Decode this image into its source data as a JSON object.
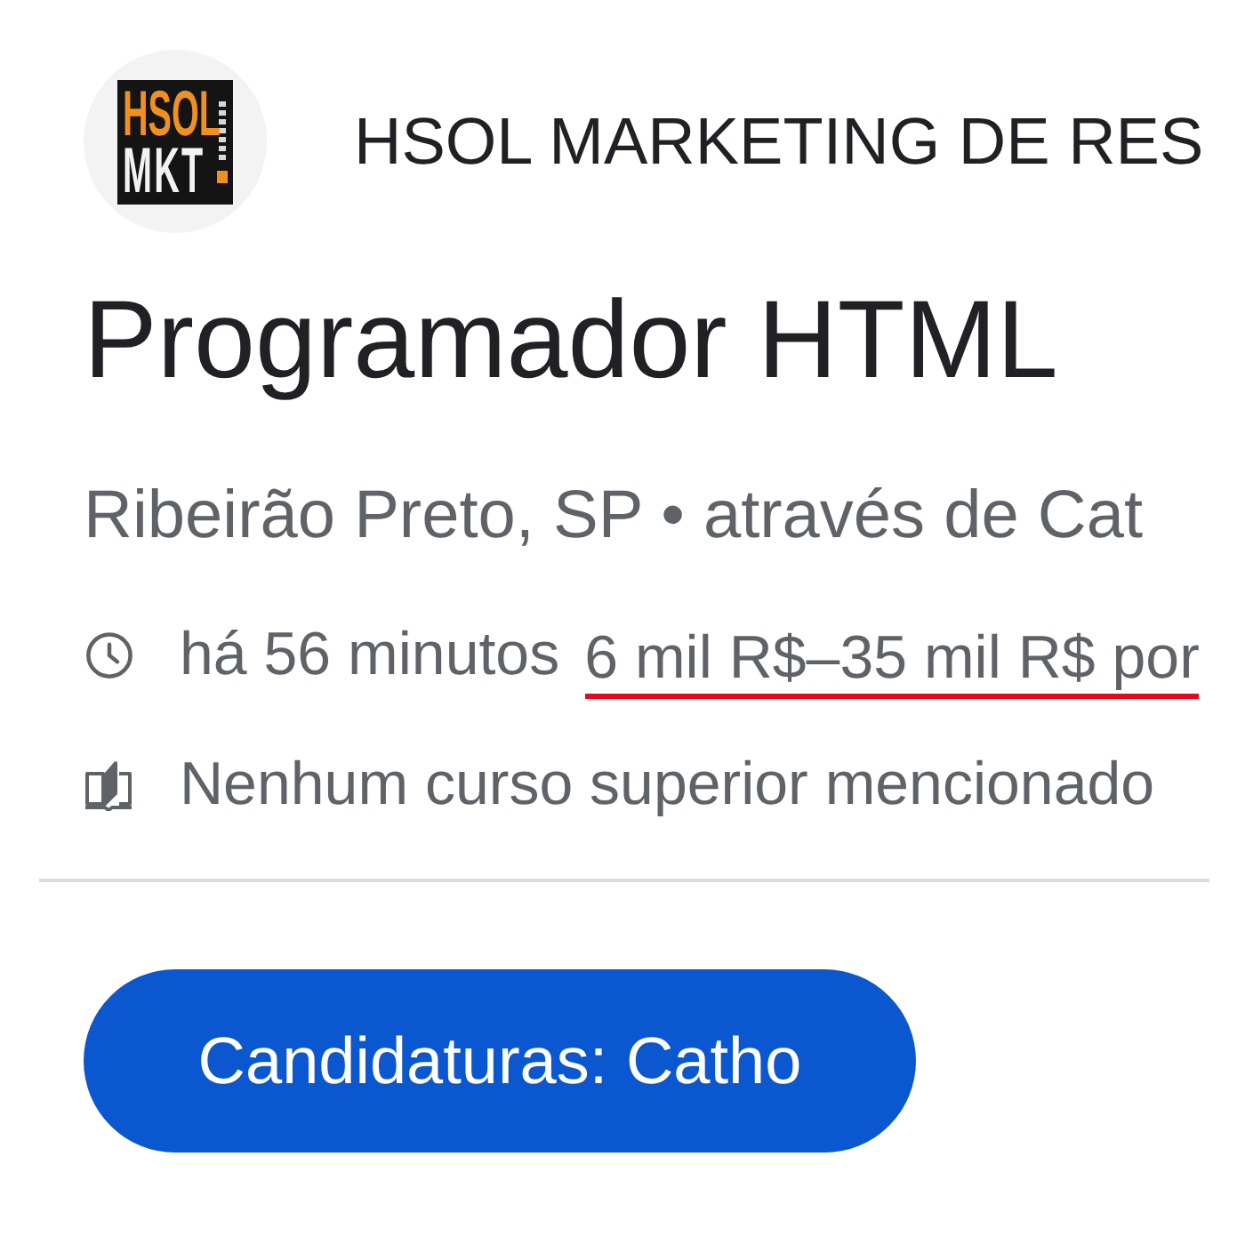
{
  "company": {
    "logo": {
      "line_1": "HSOL",
      "line_2": "MKT"
    },
    "name": "HSOL MARKETING DE RES"
  },
  "job": {
    "title": "Programador HTML",
    "location": "Ribeirão Preto, SP • através de Cat"
  },
  "details": [
    {
      "kind": "posted",
      "text": "há 56 minutos",
      "salary": {
        "text": "6 mil R$–35 mil R$ por",
        "underlined": true
      }
    },
    {
      "kind": "education",
      "text": "Nenhum curso superior mencionado"
    }
  ],
  "apply_button": {
    "label": "Candidaturas: Catho"
  }
}
